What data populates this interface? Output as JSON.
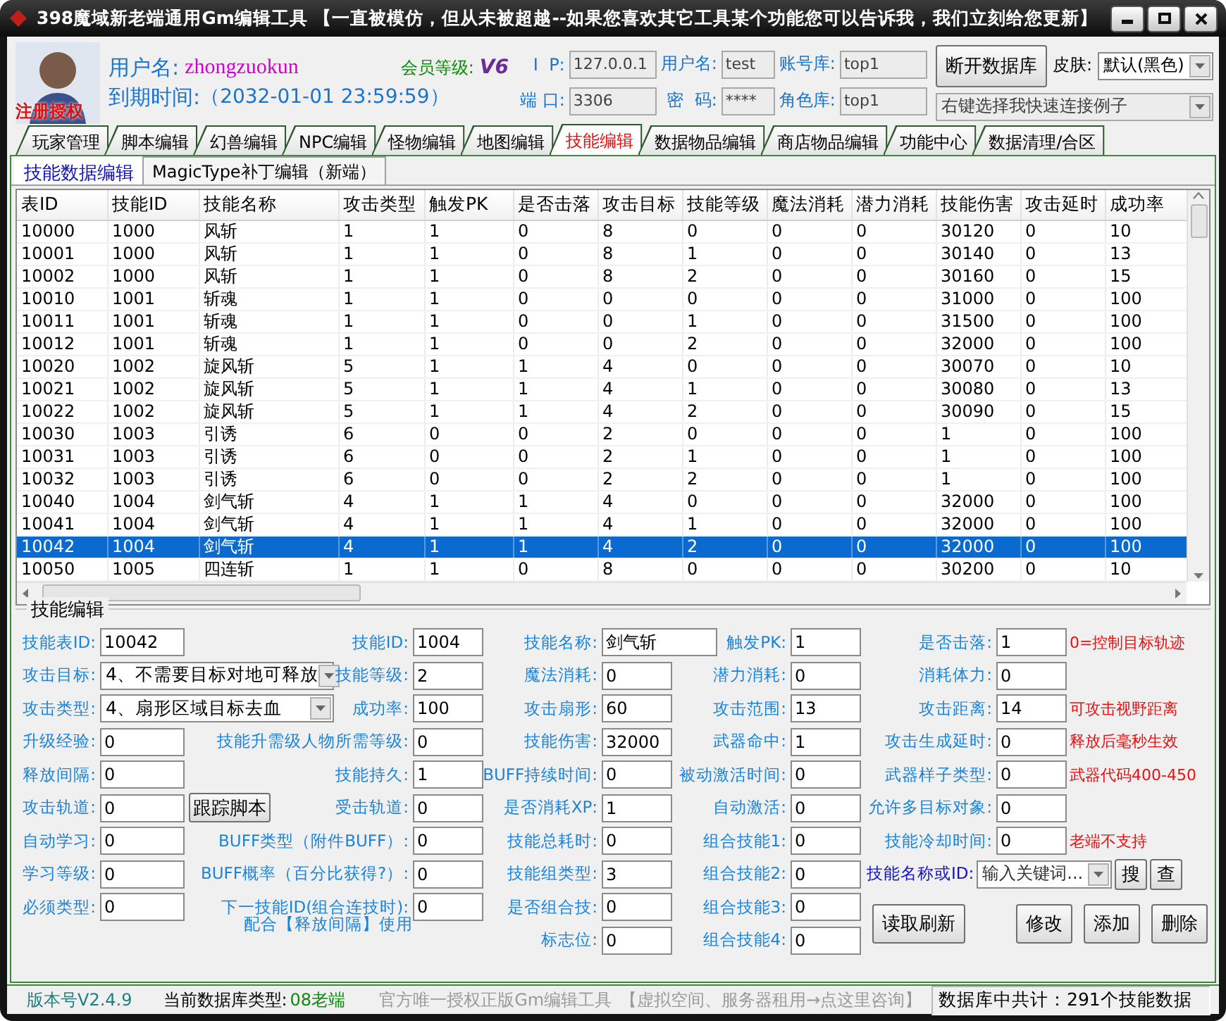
{
  "window": {
    "title": "398魔域新老端通用Gm编辑工具 【一直被模仿，但从未被超越--如果您喜欢其它工具某个功能您可以告诉我，我们立刻给您更新】"
  },
  "header": {
    "logo_text": "注册授权",
    "user_label": "用户名:",
    "user": "zhongzuokun",
    "vip_label": "会员等级:",
    "vip": "V6",
    "expiry_label": "到期时间:",
    "expiry": "（2032-01-01 23:59:59）",
    "connection": [
      {
        "label": "I  P:",
        "value": "127.0.0.1",
        "disabled": true
      },
      {
        "label": "用户名:",
        "value": "test",
        "disabled": true
      },
      {
        "label": "账号库:",
        "value": "top1",
        "disabled": true
      },
      {
        "label": "端 口:",
        "value": "3306",
        "disabled": true
      },
      {
        "label": "密  码:",
        "value": "****",
        "disabled": true
      },
      {
        "label": "角色库:",
        "value": "top1",
        "disabled": true
      }
    ],
    "disconnect_button": "断开数据库",
    "skin_label": "皮肤:",
    "skin": "默认(黑色)",
    "preset": {
      "value": "右键选择我快速连接例子",
      "disabled": true
    }
  },
  "tabs": [
    {
      "label": "玩家管理",
      "selected": false
    },
    {
      "label": "脚本编辑",
      "selected": false
    },
    {
      "label": "幻兽编辑",
      "selected": false
    },
    {
      "label": "NPC编辑",
      "selected": false
    },
    {
      "label": "怪物编辑",
      "selected": false
    },
    {
      "label": "地图编辑",
      "selected": false
    },
    {
      "label": "技能编辑",
      "selected": true
    },
    {
      "label": "数据物品编辑",
      "selected": false
    },
    {
      "label": "商店物品编辑",
      "selected": false
    },
    {
      "label": "功能中心",
      "selected": false
    },
    {
      "label": "数据清理/合区",
      "selected": false
    }
  ],
  "subtabs": [
    {
      "label": "技能数据编辑",
      "selected": true
    },
    {
      "label": "MagicType补丁编辑（新端）",
      "selected": false
    }
  ],
  "table": {
    "columns": [
      "表ID",
      "技能ID",
      "技能名称",
      "攻击类型",
      "触发PK",
      "是否击落",
      "攻击目标",
      "技能等级",
      "魔法消耗",
      "潜力消耗",
      "技能伤害",
      "攻击延时",
      "成功率"
    ],
    "rows": [
      {
        "cells": [
          "10000",
          "1000",
          "风斩",
          "1",
          "1",
          "0",
          "8",
          "0",
          "0",
          "0",
          "30120",
          "0",
          "10"
        ],
        "selected": false
      },
      {
        "cells": [
          "10001",
          "1000",
          "风斩",
          "1",
          "1",
          "0",
          "8",
          "1",
          "0",
          "0",
          "30140",
          "0",
          "13"
        ],
        "selected": false
      },
      {
        "cells": [
          "10002",
          "1000",
          "风斩",
          "1",
          "1",
          "0",
          "8",
          "2",
          "0",
          "0",
          "30160",
          "0",
          "15"
        ],
        "selected": false
      },
      {
        "cells": [
          "10010",
          "1001",
          "斩魂",
          "1",
          "1",
          "0",
          "0",
          "0",
          "0",
          "0",
          "31000",
          "0",
          "100"
        ],
        "selected": false
      },
      {
        "cells": [
          "10011",
          "1001",
          "斩魂",
          "1",
          "1",
          "0",
          "0",
          "1",
          "0",
          "0",
          "31500",
          "0",
          "100"
        ],
        "selected": false
      },
      {
        "cells": [
          "10012",
          "1001",
          "斩魂",
          "1",
          "1",
          "0",
          "0",
          "2",
          "0",
          "0",
          "32000",
          "0",
          "100"
        ],
        "selected": false
      },
      {
        "cells": [
          "10020",
          "1002",
          "旋风斩",
          "5",
          "1",
          "1",
          "4",
          "0",
          "0",
          "0",
          "30070",
          "0",
          "10"
        ],
        "selected": false
      },
      {
        "cells": [
          "10021",
          "1002",
          "旋风斩",
          "5",
          "1",
          "1",
          "4",
          "1",
          "0",
          "0",
          "30080",
          "0",
          "13"
        ],
        "selected": false
      },
      {
        "cells": [
          "10022",
          "1002",
          "旋风斩",
          "5",
          "1",
          "1",
          "4",
          "2",
          "0",
          "0",
          "30090",
          "0",
          "15"
        ],
        "selected": false
      },
      {
        "cells": [
          "10030",
          "1003",
          "引诱",
          "6",
          "0",
          "0",
          "2",
          "0",
          "0",
          "0",
          "1",
          "0",
          "100"
        ],
        "selected": false
      },
      {
        "cells": [
          "10031",
          "1003",
          "引诱",
          "6",
          "0",
          "0",
          "2",
          "1",
          "0",
          "0",
          "1",
          "0",
          "100"
        ],
        "selected": false
      },
      {
        "cells": [
          "10032",
          "1003",
          "引诱",
          "6",
          "0",
          "0",
          "2",
          "2",
          "0",
          "0",
          "1",
          "0",
          "100"
        ],
        "selected": false
      },
      {
        "cells": [
          "10040",
          "1004",
          "剑气斩",
          "4",
          "1",
          "1",
          "4",
          "0",
          "0",
          "0",
          "32000",
          "0",
          "100"
        ],
        "selected": false
      },
      {
        "cells": [
          "10041",
          "1004",
          "剑气斩",
          "4",
          "1",
          "1",
          "4",
          "1",
          "0",
          "0",
          "32000",
          "0",
          "100"
        ],
        "selected": false
      },
      {
        "cells": [
          "10042",
          "1004",
          "剑气斩",
          "4",
          "1",
          "1",
          "4",
          "2",
          "0",
          "0",
          "32000",
          "0",
          "100"
        ],
        "selected": true
      },
      {
        "cells": [
          "10050",
          "1005",
          "四连斩",
          "1",
          "1",
          "0",
          "8",
          "0",
          "0",
          "0",
          "30200",
          "0",
          "10"
        ],
        "selected": false
      }
    ]
  },
  "form": {
    "title": "技能编辑",
    "rows": [
      {
        "fields": [
          {
            "kind": "field",
            "label": "技能表ID:",
            "value": "10042"
          },
          {
            "kind": "field",
            "label": "技能ID:",
            "value": "1004"
          },
          {
            "kind": "wide",
            "label": "技能名称:",
            "value": "剑气斩"
          },
          {
            "kind": "field",
            "label": "触发PK:",
            "value": "1"
          },
          {
            "kind": "field",
            "label": "是否击落:",
            "value": "1"
          }
        ],
        "note": "0=控制目标轨迹"
      },
      {
        "fields": [
          {
            "kind": "select",
            "label": "攻击目标:",
            "value": "4、不需要目标对地可释放"
          },
          {
            "kind": "field",
            "label": "技能等级:",
            "value": "2"
          },
          {
            "kind": "field",
            "label": "魔法消耗:",
            "value": "0"
          },
          {
            "kind": "field",
            "label": "潜力消耗:",
            "value": "0"
          },
          {
            "kind": "field",
            "label": "消耗体力:",
            "value": "0"
          }
        ]
      },
      {
        "fields": [
          {
            "kind": "select",
            "label": "攻击类型:",
            "value": "4、扇形区域目标去血"
          },
          {
            "kind": "field",
            "label": "成功率:",
            "value": "100"
          },
          {
            "kind": "field",
            "label": "攻击扇形:",
            "value": "60"
          },
          {
            "kind": "field",
            "label": "攻击范围:",
            "value": "13"
          },
          {
            "kind": "field",
            "label": "攻击距离:",
            "value": "14"
          }
        ],
        "note": "可攻击视野距离"
      },
      {
        "fields": [
          {
            "kind": "field",
            "label": "升级经验:",
            "value": "0"
          },
          {
            "kind": "field",
            "label": "技能升需级人物所需等级:",
            "value": "0"
          },
          {
            "kind": "field",
            "label": "技能伤害:",
            "value": "32000"
          },
          {
            "kind": "field",
            "label": "武器命中:",
            "value": "1"
          },
          {
            "kind": "field",
            "label": "攻击生成延时:",
            "value": "0"
          }
        ],
        "note": "释放后毫秒生效"
      },
      {
        "fields": [
          {
            "kind": "field",
            "label": "释放间隔:",
            "value": "0"
          },
          {
            "kind": "field",
            "label": "技能持久:",
            "value": "1"
          },
          {
            "kind": "field",
            "label": "BUFF持续时间:",
            "value": "0"
          },
          {
            "kind": "field",
            "label": "被动激活时间:",
            "value": "0"
          },
          {
            "kind": "field",
            "label": "武器样子类型:",
            "value": "0"
          }
        ],
        "note": "武器代码400-450"
      },
      {
        "fields": [
          {
            "kind": "button_field",
            "label": "攻击轨道:",
            "value": "0",
            "button": "跟踪脚本"
          },
          {
            "kind": "field",
            "label": "受击轨道:",
            "value": "0"
          },
          {
            "kind": "field",
            "label": "是否消耗XP:",
            "value": "1"
          },
          {
            "kind": "field",
            "label": "自动激活:",
            "value": "0"
          },
          {
            "kind": "field",
            "label": "允许多目标对象:",
            "value": "0"
          }
        ]
      },
      {
        "fields": [
          {
            "kind": "field",
            "label": "自动学习:",
            "value": "0"
          },
          {
            "kind": "field",
            "label": "BUFF类型（附件BUFF）:",
            "value": "0"
          },
          {
            "kind": "field",
            "label": "技能总耗时:",
            "value": "0"
          },
          {
            "kind": "field",
            "label": "组合技能1:",
            "value": "0"
          },
          {
            "kind": "field",
            "label": "技能冷却时间:",
            "value": "0"
          }
        ],
        "note": "老端不支持"
      },
      {
        "fields": [
          {
            "kind": "field",
            "label": "学习等级:",
            "value": "0"
          },
          {
            "kind": "field",
            "label": "BUFF概率（百分比获得?）:",
            "value": "0"
          },
          {
            "kind": "field",
            "label": "技能组类型:",
            "value": "3"
          },
          {
            "kind": "field",
            "label": "组合技能2:",
            "value": "0"
          }
        ]
      },
      {
        "fields": [
          {
            "kind": "field",
            "label": "必须类型:",
            "value": "0"
          },
          {
            "kind": "field",
            "label": "下一技能ID(组合连技时):",
            "value": "0"
          },
          {
            "kind": "field",
            "label": "是否组合技:",
            "value": "0"
          },
          {
            "kind": "field",
            "label": "组合技能3:",
            "value": "0"
          }
        ]
      },
      {
        "fields": [
          {
            "kind": "hint",
            "text": "配合【释放间隔】使用"
          },
          {
            "kind": "field",
            "label": "标志位:",
            "value": "0"
          },
          {
            "kind": "field",
            "label": "组合技能4:",
            "value": "0"
          }
        ]
      }
    ],
    "search": {
      "label": "技能名称或ID:",
      "placeholder": "输入关键词...",
      "buttons": [
        "搜",
        "查"
      ]
    },
    "buttons": [
      "读取刷新",
      "修改",
      "添加",
      "删除"
    ]
  },
  "status_bar": {
    "version": "版本号V2.4.9",
    "db_type_label": "当前数据库类型:",
    "db_type": "08老端",
    "notice": "官方唯一授权正版Gm编辑工具",
    "link": "【虚拟空间、服务器租用→点这里咨询】",
    "count": "数据库中共计：291个技能数据"
  }
}
